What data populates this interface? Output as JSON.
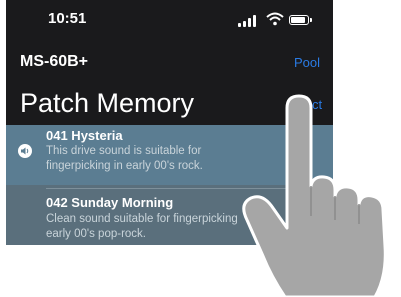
{
  "status_bar": {
    "time": "10:51"
  },
  "header": {
    "app_title": "MS-60B+",
    "pool_label": "Pool",
    "page_title": "Patch Memory",
    "select_label": "Select"
  },
  "patches": [
    {
      "title": "041 Hysteria",
      "description_line1": "This drive sound is suitable for",
      "description_line2": "fingerpicking in early 00's rock."
    },
    {
      "title": "042 Sunday Morning",
      "description_line1": "Clean sound suitable for fingerpicking",
      "description_line2": "early 00's pop-rock."
    }
  ]
}
